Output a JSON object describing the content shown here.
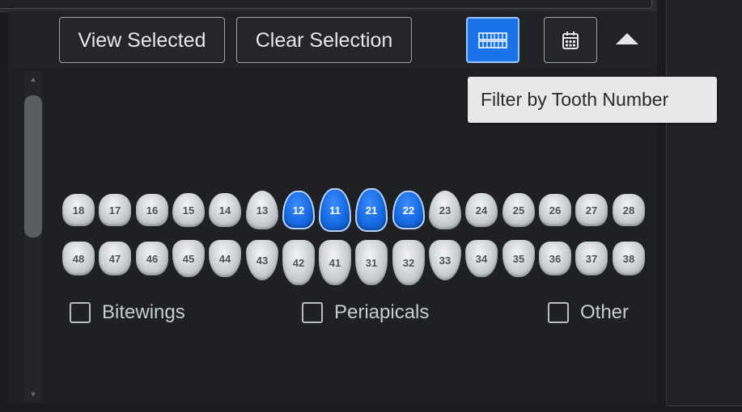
{
  "toolbar": {
    "view_selected_label": "View Selected",
    "clear_selection_label": "Clear Selection",
    "filter_tooth_icon": "teeth-icon",
    "filter_date_icon": "calendar-icon",
    "collapse_icon": "chevron-up-icon",
    "accent_color": "#1a73e8"
  },
  "tooltip": {
    "text": "Filter by Tooth Number"
  },
  "teeth": {
    "upper": [
      {
        "number": "18",
        "selected": false
      },
      {
        "number": "17",
        "selected": false
      },
      {
        "number": "16",
        "selected": false
      },
      {
        "number": "15",
        "selected": false
      },
      {
        "number": "14",
        "selected": false
      },
      {
        "number": "13",
        "selected": false
      },
      {
        "number": "12",
        "selected": true
      },
      {
        "number": "11",
        "selected": true
      },
      {
        "number": "21",
        "selected": true
      },
      {
        "number": "22",
        "selected": true
      },
      {
        "number": "23",
        "selected": false
      },
      {
        "number": "24",
        "selected": false
      },
      {
        "number": "25",
        "selected": false
      },
      {
        "number": "26",
        "selected": false
      },
      {
        "number": "27",
        "selected": false
      },
      {
        "number": "28",
        "selected": false
      }
    ],
    "lower": [
      {
        "number": "48",
        "selected": false
      },
      {
        "number": "47",
        "selected": false
      },
      {
        "number": "46",
        "selected": false
      },
      {
        "number": "45",
        "selected": false
      },
      {
        "number": "44",
        "selected": false
      },
      {
        "number": "43",
        "selected": false
      },
      {
        "number": "42",
        "selected": false
      },
      {
        "number": "41",
        "selected": false
      },
      {
        "number": "31",
        "selected": false
      },
      {
        "number": "32",
        "selected": false
      },
      {
        "number": "33",
        "selected": false
      },
      {
        "number": "34",
        "selected": false
      },
      {
        "number": "35",
        "selected": false
      },
      {
        "number": "36",
        "selected": false
      },
      {
        "number": "37",
        "selected": false
      },
      {
        "number": "38",
        "selected": false
      }
    ]
  },
  "filters": {
    "bitewings": {
      "label": "Bitewings",
      "checked": false
    },
    "periapicals": {
      "label": "Periapicals",
      "checked": false
    },
    "other": {
      "label": "Other",
      "checked": false
    }
  }
}
